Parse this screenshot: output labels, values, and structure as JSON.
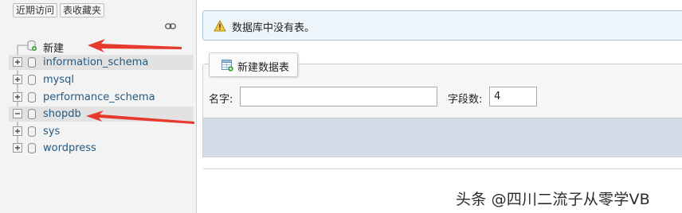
{
  "nav": {
    "tabs": [
      {
        "label": "近期访问"
      },
      {
        "label": "表收藏夹"
      }
    ],
    "link_icon": "chain-link-icon",
    "tree": [
      {
        "label": "新建",
        "expander": "none",
        "icon": "new-db-icon"
      },
      {
        "label": "information_schema",
        "expander": "plus",
        "icon": "database-icon"
      },
      {
        "label": "mysql",
        "expander": "plus",
        "icon": "database-icon"
      },
      {
        "label": "performance_schema",
        "expander": "plus",
        "icon": "database-icon"
      },
      {
        "label": "shopdb",
        "expander": "minus",
        "icon": "database-icon",
        "selected": true
      },
      {
        "label": "sys",
        "expander": "plus",
        "icon": "database-icon"
      },
      {
        "label": "wordpress",
        "expander": "plus",
        "icon": "database-icon"
      }
    ]
  },
  "main": {
    "notice": {
      "icon": "warning-icon",
      "text": "数据库中没有表。"
    },
    "create_table": {
      "legend_label": "新建数据表",
      "legend_icon": "new-table-icon",
      "name_label": "名字:",
      "name_value": "",
      "columns_label": "字段数:",
      "columns_value": "4"
    }
  },
  "annotations": {
    "arrows_color": "#e8392f"
  },
  "watermark": "头条 @四川二流子从零学VB",
  "colors": {
    "link": "#235a81",
    "notice_bg": "#eef5fa",
    "action_bar": "#d4dde7"
  }
}
